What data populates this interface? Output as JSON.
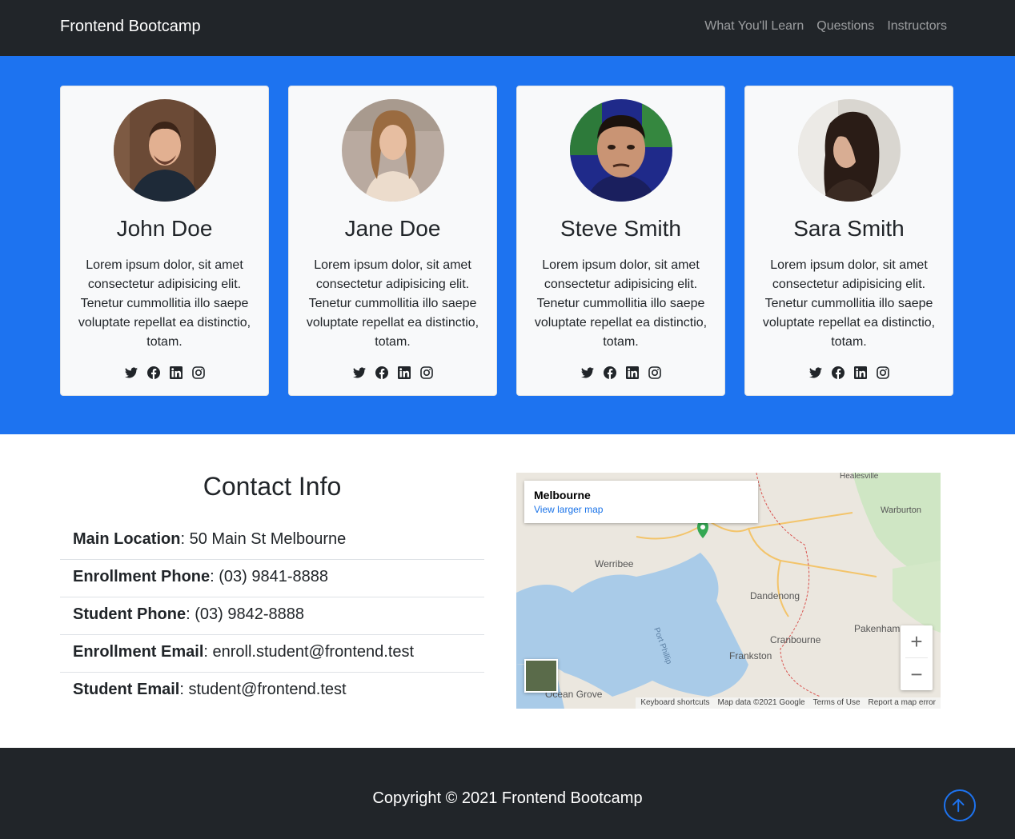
{
  "navbar": {
    "brand": "Frontend Bootcamp",
    "links": [
      "What You'll Learn",
      "Questions",
      "Instructors"
    ]
  },
  "instructors": [
    {
      "name": "John Doe",
      "bio": "Lorem ipsum dolor, sit amet consectetur adipisicing elit. Tenetur cummollitia illo saepe voluptate repellat ea distinctio, totam."
    },
    {
      "name": "Jane Doe",
      "bio": "Lorem ipsum dolor, sit amet consectetur adipisicing elit. Tenetur cummollitia illo saepe voluptate repellat ea distinctio, totam."
    },
    {
      "name": "Steve Smith",
      "bio": "Lorem ipsum dolor, sit amet consectetur adipisicing elit. Tenetur cummollitia illo saepe voluptate repellat ea distinctio, totam."
    },
    {
      "name": "Sara Smith",
      "bio": "Lorem ipsum dolor, sit amet consectetur adipisicing elit. Tenetur cummollitia illo saepe voluptate repellat ea distinctio, totam."
    }
  ],
  "social_icons": [
    "twitter-icon",
    "facebook-icon",
    "linkedin-icon",
    "instagram-icon"
  ],
  "contact": {
    "title": "Contact Info",
    "items": [
      {
        "label": "Main Location",
        "value": ": 50 Main St Melbourne"
      },
      {
        "label": "Enrollment Phone",
        "value": ": (03) 9841-8888"
      },
      {
        "label": "Student Phone",
        "value": ": (03) 9842-8888"
      },
      {
        "label": "Enrollment Email",
        "value": ": enroll.student@frontend.test"
      },
      {
        "label": "Student Email",
        "value": ": student@frontend.test"
      }
    ]
  },
  "map": {
    "place": "Melbourne",
    "larger_link": "View larger map",
    "zoom_in": "+",
    "zoom_out": "−",
    "footer": [
      "Keyboard shortcuts",
      "Map data ©2021 Google",
      "Terms of Use",
      "Report a map error"
    ],
    "labels": [
      "Werribee",
      "Dandenong",
      "Frankston",
      "Cranbourne",
      "Pakenham",
      "Ocean Grove",
      "Warburton",
      "Healesville",
      "Port Phillip"
    ]
  },
  "footer": {
    "copyright": "Copyright © 2021 Frontend Bootcamp"
  },
  "colors": {
    "primary": "#1d73f0",
    "dark": "#212529",
    "light": "#f8f9fa"
  }
}
